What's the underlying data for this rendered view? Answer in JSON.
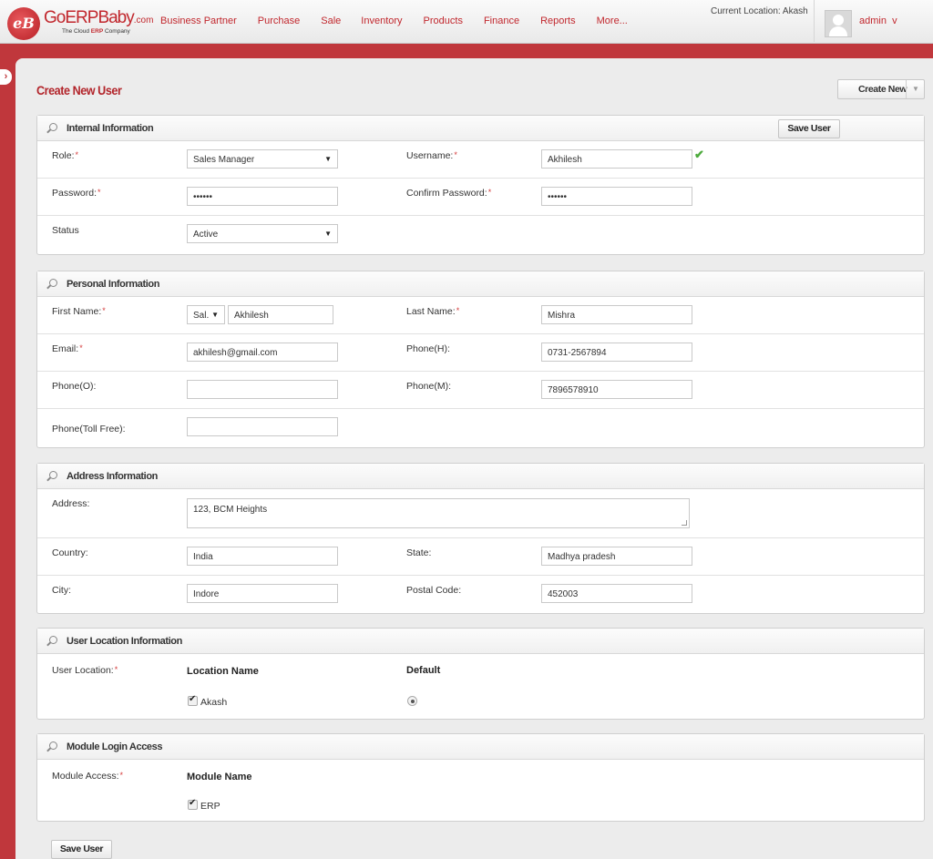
{
  "brand": {
    "name_go": "Go",
    "name_erp": "ERP",
    "name_baby": "Baby",
    "name_com": ".com",
    "tagline_pre": "The Cloud ",
    "tagline_erp": "ERP",
    "tagline_post": " Company",
    "mark": "eB"
  },
  "nav": [
    "Business Partner",
    "Purchase",
    "Sale",
    "Inventory",
    "Products",
    "Finance",
    "Reports",
    "More..."
  ],
  "current_location": "Current Location: Akash",
  "user": {
    "name": "admin",
    "caret": "v"
  },
  "page": {
    "title": "Create New User",
    "create_new_label": "Create New"
  },
  "internal": {
    "title": "Internal Information",
    "save_label": "Save User",
    "role_label": "Role:",
    "role_value": "Sales Manager",
    "username_label": "Username:",
    "username_value": "Akhilesh",
    "password_label": "Password:",
    "password_value": "••••••",
    "confirm_label": "Confirm Password:",
    "confirm_value": "••••••",
    "status_label": "Status",
    "status_value": "Active"
  },
  "personal": {
    "title": "Personal Information",
    "first_label": "First Name:",
    "salutation": "Sal.",
    "first_value": "Akhilesh",
    "last_label": "Last Name:",
    "last_value": "Mishra",
    "email_label": "Email:",
    "email_value": "akhilesh@gmail.com",
    "phoneh_label": "Phone(H):",
    "phoneh_value": "0731-2567894",
    "phoneo_label": "Phone(O):",
    "phoneo_value": "",
    "phonem_label": "Phone(M):",
    "phonem_value": "7896578910",
    "phonetf_label": "Phone(Toll Free):",
    "phonetf_value": ""
  },
  "address": {
    "title": "Address Information",
    "address_label": "Address:",
    "address_value": "123, BCM Heights",
    "country_label": "Country:",
    "country_value": "India",
    "state_label": "State:",
    "state_value": "Madhya pradesh",
    "city_label": "City:",
    "city_value": "Indore",
    "postal_label": "Postal Code:",
    "postal_value": "452003"
  },
  "location": {
    "title": "User Location Information",
    "label": "User Location:",
    "col_name": "Location Name",
    "col_default": "Default",
    "items": [
      {
        "name": "Akash",
        "checked": true,
        "default": true
      }
    ]
  },
  "module": {
    "title": "Module Login Access",
    "label": "Module Access:",
    "col_name": "Module Name",
    "items": [
      {
        "name": "ERP",
        "checked": true
      }
    ]
  },
  "footer": {
    "save_label": "Save User"
  },
  "colors": {
    "brand_red": "#c1272d",
    "required": "#d53b3b",
    "valid_check": "#4caa3c"
  }
}
